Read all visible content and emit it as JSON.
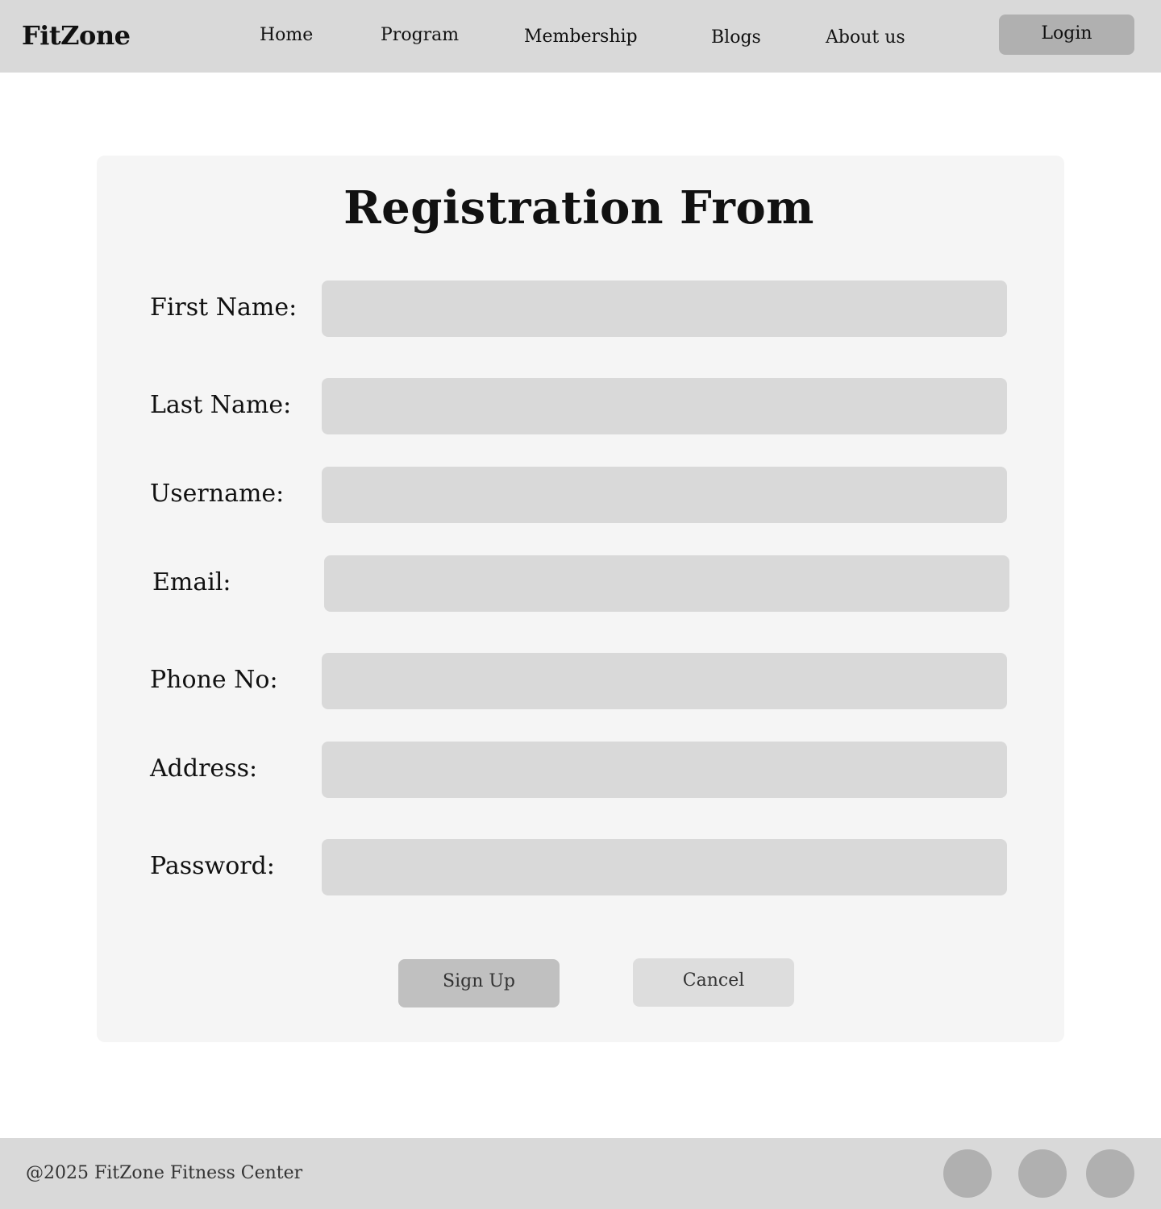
{
  "header": {
    "brand": "FitZone",
    "nav": {
      "home": "Home",
      "program": "Program",
      "membership": "Membership",
      "blogs": "Blogs",
      "about": "About us"
    },
    "login_label": "Login"
  },
  "form": {
    "title": "Registration From",
    "fields": {
      "first_name": {
        "label": "First Name:",
        "value": "",
        "placeholder": ""
      },
      "last_name": {
        "label": "Last Name:",
        "value": "",
        "placeholder": ""
      },
      "username": {
        "label": "Username:",
        "value": "",
        "placeholder": ""
      },
      "email": {
        "label": "Email:",
        "value": "",
        "placeholder": ""
      },
      "phone": {
        "label": "Phone No:",
        "value": "",
        "placeholder": ""
      },
      "address": {
        "label": "Address:",
        "value": "",
        "placeholder": ""
      },
      "password": {
        "label": "Password:",
        "value": "",
        "placeholder": ""
      }
    },
    "signup_label": "Sign Up",
    "cancel_label": "Cancel"
  },
  "footer": {
    "copyright": "@2025 FitZone Fitness Center",
    "social_icons": [
      "social-icon",
      "social-icon",
      "social-icon"
    ]
  },
  "colors": {
    "header_bg": "#d9d9d9",
    "card_bg": "#f5f5f5",
    "input_bg": "#d9d9d9",
    "login_bg": "#b0b0b0",
    "signup_bg": "#c0c0c0",
    "cancel_bg": "#dddddd",
    "social_bg": "#b0b0b0"
  }
}
